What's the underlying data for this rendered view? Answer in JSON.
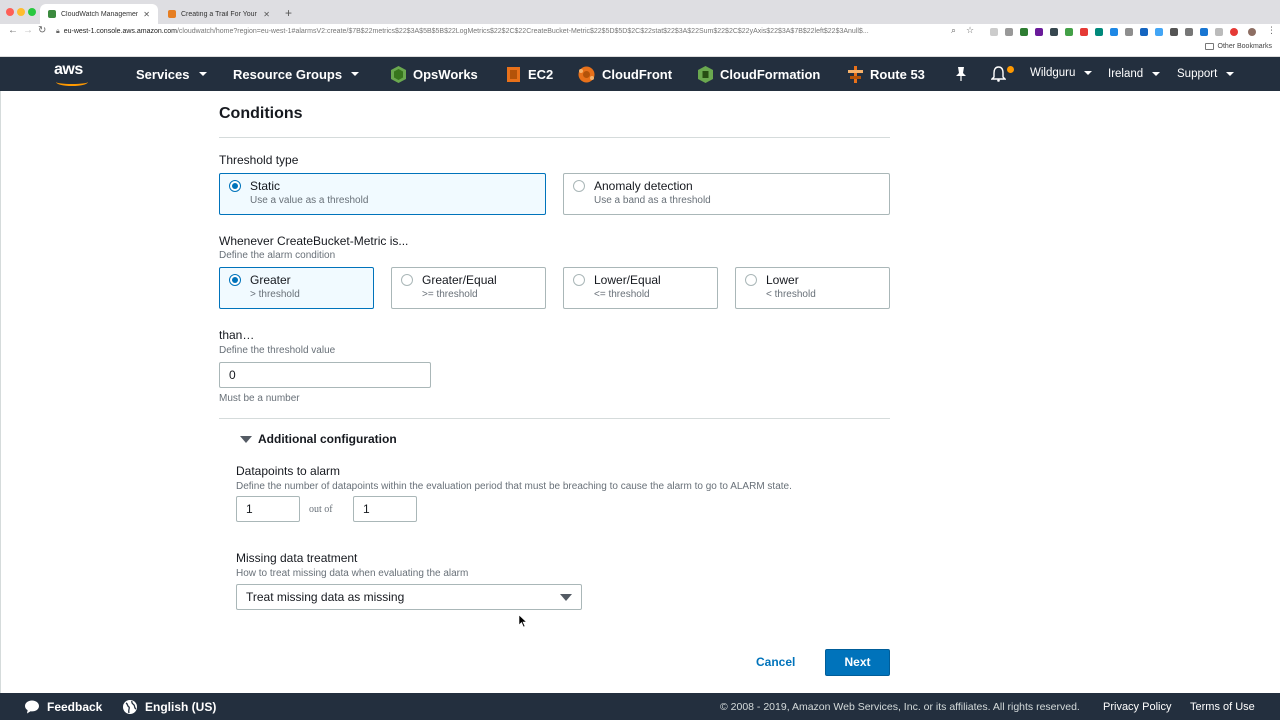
{
  "browser": {
    "tabs": [
      {
        "title": "CloudWatch Management Con",
        "active": true
      },
      {
        "title": "Creating a Trail For Your AWS",
        "active": false
      }
    ],
    "url_host": "eu-west-1.console.aws.amazon.com",
    "url_path": "/cloudwatch/home?region=eu-west-1#alarmsV2:create/$7B$22metrics$22$3A$5B$5B$22LogMetrics$22$2C$22CreateBucket-Metric$22$5D$5D$2C$22stat$22$3A$22Sum$22$2C$22yAxis$22$3A$7B$22left$22$3Anull$...",
    "bookmarks_label": "Other Bookmarks"
  },
  "header": {
    "logo_text": "aws",
    "services": "Services",
    "resource_groups": "Resource Groups",
    "pinned": [
      "OpsWorks",
      "EC2",
      "CloudFront",
      "CloudFormation",
      "Route 53"
    ],
    "account": "Wildguru",
    "region": "Ireland",
    "support": "Support"
  },
  "conditions": {
    "title": "Conditions",
    "threshold_type_label": "Threshold type",
    "threshold_types": [
      {
        "title": "Static",
        "desc": "Use a value as a threshold",
        "selected": true
      },
      {
        "title": "Anomaly detection",
        "desc": "Use a band as a threshold",
        "selected": false
      }
    ],
    "whenever_label": "Whenever CreateBucket-Metric is...",
    "whenever_desc": "Define the alarm condition",
    "operators": [
      {
        "title": "Greater",
        "desc": "> threshold",
        "selected": true
      },
      {
        "title": "Greater/Equal",
        "desc": ">= threshold",
        "selected": false
      },
      {
        "title": "Lower/Equal",
        "desc": "<= threshold",
        "selected": false
      },
      {
        "title": "Lower",
        "desc": "< threshold",
        "selected": false
      }
    ],
    "than_label": "than…",
    "than_desc": "Define the threshold value",
    "threshold_value": "0",
    "threshold_hint": "Must be a number"
  },
  "additional": {
    "title": "Additional configuration",
    "datapoints_label": "Datapoints to alarm",
    "datapoints_desc": "Define the number of datapoints within the evaluation period that must be breaching to cause the alarm to go to ALARM state.",
    "datapoints_value": "1",
    "out_of_label": "out of",
    "evaluation_value": "1",
    "missing_label": "Missing data treatment",
    "missing_desc": "How to treat missing data when evaluating the alarm",
    "missing_value": "Treat missing data as missing"
  },
  "actions": {
    "cancel": "Cancel",
    "next": "Next"
  },
  "footer": {
    "feedback": "Feedback",
    "language": "English (US)",
    "copyright": "© 2008 - 2019, Amazon Web Services, Inc. or its affiliates. All rights reserved.",
    "privacy": "Privacy Policy",
    "terms": "Terms of Use"
  },
  "colors": {
    "nav_bg": "#232f3e",
    "primary": "#0073bb",
    "accent": "#ff9900"
  }
}
